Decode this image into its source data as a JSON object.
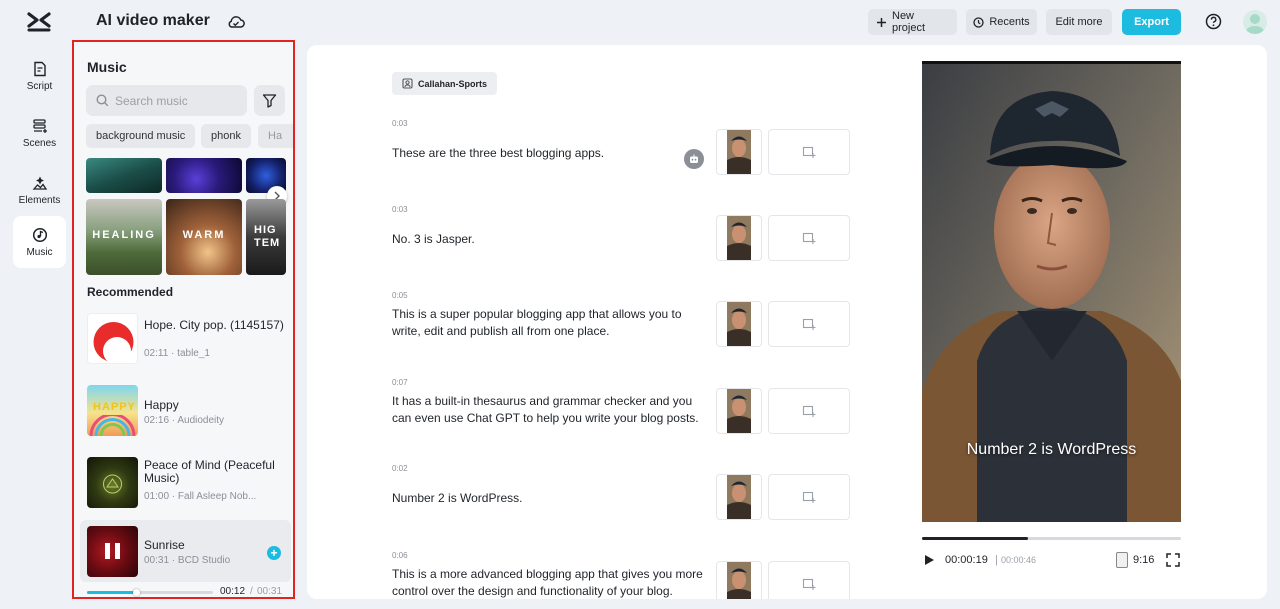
{
  "header": {
    "app_title": "AI video maker",
    "new_project": "New project",
    "recents": "Recents",
    "edit_more": "Edit more",
    "export": "Export"
  },
  "rail": [
    {
      "label": "Script",
      "icon": "script-icon"
    },
    {
      "label": "Scenes",
      "icon": "scenes-icon"
    },
    {
      "label": "Elements",
      "icon": "elements-icon"
    },
    {
      "label": "Music",
      "icon": "music-icon",
      "active": true
    }
  ],
  "music": {
    "title": "Music",
    "search_placeholder": "Search music",
    "chips": [
      "background music",
      "phonk",
      "Ha"
    ],
    "moods": [
      "HEALING",
      "WARM",
      "HIG TEM"
    ],
    "recommended_title": "Recommended",
    "tracks": [
      {
        "name": "Hope. City pop. (1145157)",
        "meta": "02:11 · table_1"
      },
      {
        "name": "Happy",
        "meta": "02:16 · Audiodeity"
      },
      {
        "name": "Peace of Mind (Peaceful Music)",
        "meta": "01:00 · Fall Asleep Nob..."
      },
      {
        "name": "Sunrise",
        "meta": "00:31 · BCD Studio",
        "playing": true
      }
    ],
    "playback": {
      "current": "00:12",
      "separator": "/",
      "total": "00:31",
      "progress": 0.39
    }
  },
  "script": {
    "speaker": "Callahan-Sports",
    "scenes": [
      {
        "time": "0:03",
        "text": "These are the three best blogging apps."
      },
      {
        "time": "0:03",
        "text": "No. 3 is Jasper."
      },
      {
        "time": "0:05",
        "text": "This is a super popular blogging app that allows you to write, edit and publish all from one place."
      },
      {
        "time": "0:07",
        "text": "It has a built-in thesaurus and grammar checker and you can even use Chat GPT to help you write your blog posts."
      },
      {
        "time": "0:02",
        "text": "Number 2 is WordPress."
      },
      {
        "time": "0:06",
        "text": "This is a more advanced blogging app that gives you more control over the design and functionality of your blog."
      }
    ]
  },
  "preview": {
    "caption": "Number 2 is WordPress",
    "current": "00:00:19",
    "separator": "|",
    "total": "00:00:46",
    "ratio": "9:16",
    "progress": 0.41
  },
  "colors": {
    "accent": "#1ebbe0",
    "highlight_border": "#e02323"
  }
}
